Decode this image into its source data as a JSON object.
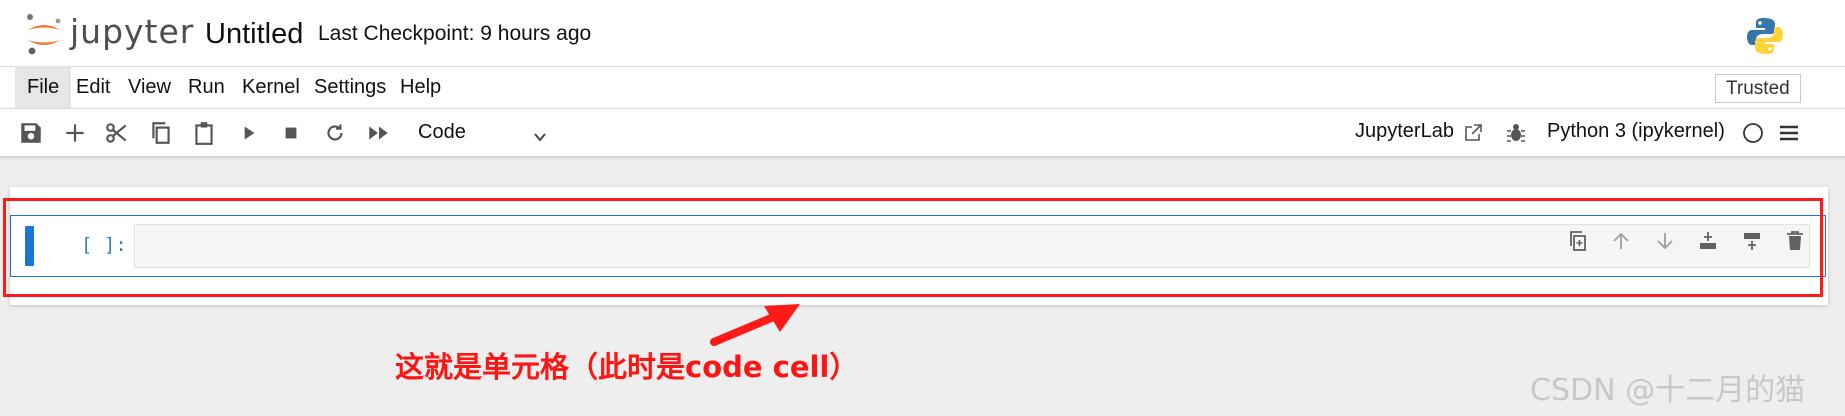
{
  "header": {
    "logo_text": "jupyter",
    "title": "Untitled",
    "checkpoint": "Last Checkpoint: 9 hours ago",
    "kernel_logo": "python-logo"
  },
  "menubar": {
    "items": [
      "File",
      "Edit",
      "View",
      "Run",
      "Kernel",
      "Settings",
      "Help"
    ],
    "active": "File",
    "trusted": "Trusted"
  },
  "toolbar": {
    "icons": [
      "save-icon",
      "plus-icon",
      "cut-icon",
      "copy-icon",
      "paste-icon",
      "run-icon",
      "stop-icon",
      "restart-icon",
      "fast-forward-icon"
    ],
    "cell_type": "Code",
    "jupyterlab_link": "JupyterLab",
    "kernel_name": "Python 3 (ipykernel)"
  },
  "cell": {
    "prompt": "[ ]:",
    "content": "",
    "icons": [
      "duplicate-icon",
      "move-up-icon",
      "move-down-icon",
      "insert-above-icon",
      "insert-below-icon",
      "delete-icon"
    ]
  },
  "annotation": {
    "text": "这就是单元格（此时是code cell）",
    "color": "#ff1414"
  },
  "watermark": "CSDN @十二月的猫",
  "colors": {
    "accent": "#1976d2",
    "annotation": "#ff1414",
    "jupyter_orange": "#f37726"
  }
}
